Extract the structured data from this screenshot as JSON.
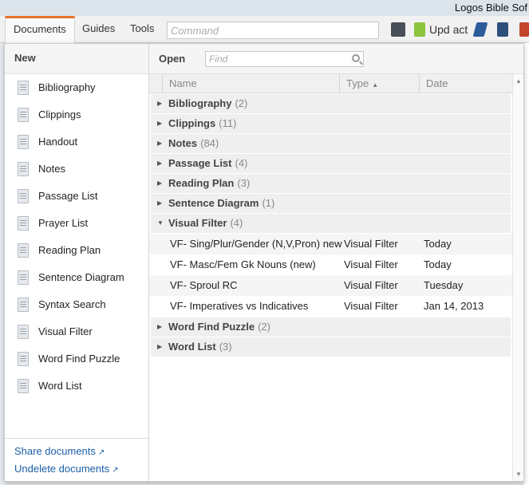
{
  "app": {
    "title": "Logos Bible Sof"
  },
  "toolbar": {
    "tabs": [
      "Documents",
      "Guides",
      "Tools"
    ],
    "command_placeholder": "Command",
    "update_label": "Upd act"
  },
  "new_pane": {
    "heading": "New",
    "items": [
      {
        "label": "Bibliography",
        "icon": "bibliography-icon"
      },
      {
        "label": "Clippings",
        "icon": "clippings-icon"
      },
      {
        "label": "Handout",
        "icon": "handout-icon"
      },
      {
        "label": "Notes",
        "icon": "notes-icon"
      },
      {
        "label": "Passage List",
        "icon": "passage-list-icon"
      },
      {
        "label": "Prayer List",
        "icon": "prayer-list-icon"
      },
      {
        "label": "Reading Plan",
        "icon": "reading-plan-icon"
      },
      {
        "label": "Sentence Diagram",
        "icon": "sentence-diagram-icon"
      },
      {
        "label": "Syntax Search",
        "icon": "syntax-search-icon"
      },
      {
        "label": "Visual Filter",
        "icon": "visual-filter-icon"
      },
      {
        "label": "Word Find Puzzle",
        "icon": "word-find-puzzle-icon"
      },
      {
        "label": "Word List",
        "icon": "word-list-icon"
      }
    ],
    "links": [
      "Share documents",
      "Undelete documents"
    ]
  },
  "open_pane": {
    "heading": "Open",
    "find_placeholder": "Find",
    "columns": [
      "Name",
      "Type",
      "Date"
    ],
    "groups": [
      {
        "name": "Bibliography",
        "count": "(2)",
        "expanded": false
      },
      {
        "name": "Clippings",
        "count": "(11)",
        "expanded": false
      },
      {
        "name": "Notes",
        "count": "(84)",
        "expanded": false
      },
      {
        "name": "Passage List",
        "count": "(4)",
        "expanded": false
      },
      {
        "name": "Reading Plan",
        "count": "(3)",
        "expanded": false
      },
      {
        "name": "Sentence Diagram",
        "count": "(1)",
        "expanded": false
      },
      {
        "name": "Visual Filter",
        "count": "(4)",
        "expanded": true
      },
      {
        "name": "Word Find Puzzle",
        "count": "(2)",
        "expanded": false
      },
      {
        "name": "Word List",
        "count": "(3)",
        "expanded": false
      }
    ],
    "visual_filter_items": [
      {
        "name": "VF- Sing/Plur/Gender (N,V,Pron) new",
        "type": "Visual Filter",
        "date": "Today"
      },
      {
        "name": "VF- Masc/Fem Gk Nouns (new)",
        "type": "Visual Filter",
        "date": "Today"
      },
      {
        "name": "VF- Sproul RC",
        "type": "Visual Filter",
        "date": "Tuesday"
      },
      {
        "name": "VF- Imperatives vs Indicatives",
        "type": "Visual Filter",
        "date": "Jan 14, 2013"
      }
    ]
  },
  "colors": {
    "accent": "#e8732a",
    "link": "#1a5ea8"
  }
}
